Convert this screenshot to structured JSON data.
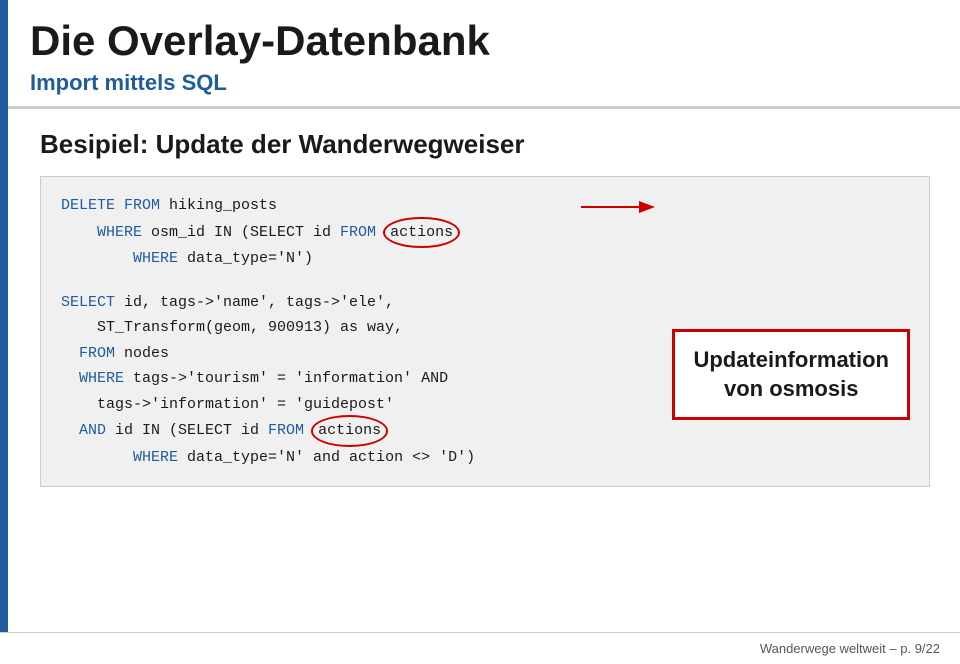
{
  "header": {
    "main_title": "Die Overlay-Datenbank",
    "subtitle": "Import mittels SQL"
  },
  "main": {
    "example_title": "Besipiel: Update der Wanderwegweiser",
    "sql_block1": {
      "line1_kw": "DELETE FROM ",
      "line1_rest": "hiking_posts",
      "line2_kw1": "    WHERE ",
      "line2_rest": "osm_id IN (SELECT id ",
      "line2_kw2": "FROM",
      "line2_circle": "actions",
      "line3_kw": "        WHERE ",
      "line3_rest": "data_type='N')"
    },
    "sql_block2": {
      "line1_kw": "SELECT ",
      "line1_rest": "id, tags->'name', tags->'ele',",
      "line2_rest": "    ST_Transform(geom, 900913) as way,",
      "line3_kw": "  FROM ",
      "line3_rest": "nodes",
      "line4_kw": "  WHERE ",
      "line4_rest": "tags->'tourism' = 'information' AND",
      "line5_rest": "    tags->'information' = 'guidepost'",
      "line6_kw": "  AND ",
      "line6_rest": "id IN (SELECT id ",
      "line6_kw2": "FROM",
      "line6_circle": "actions",
      "line7_kw": "        WHERE ",
      "line7_rest": "data_type='N' and action <> 'D')"
    },
    "update_box": {
      "line1": "Updateinformation",
      "line2": "von osmosis"
    }
  },
  "footer": {
    "text": "Wanderwege weltweit – p. 9/22"
  }
}
